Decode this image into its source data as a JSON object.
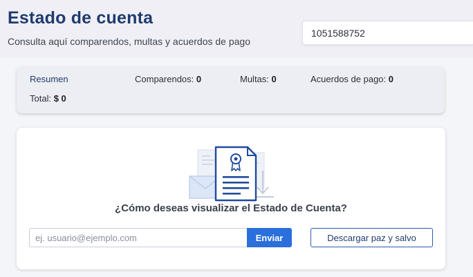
{
  "header": {
    "title": "Estado de cuenta",
    "subtitle": "Consulta aquí comparendos, multas y acuerdos de pago",
    "document_id": "1051588752"
  },
  "summary": {
    "resumen_label": "Resumen",
    "comparendos_label": "Comparendos:",
    "comparendos_value": "0",
    "multas_label": "Multas:",
    "multas_value": "0",
    "acuerdos_label": "Acuerdos de pago:",
    "acuerdos_value": "0",
    "total_label": "Total:",
    "total_value": "$ 0"
  },
  "card": {
    "illustration_icon": "document-certificate-icon",
    "question": "¿Cómo deseas visualizar el Estado de Cuenta?",
    "email_placeholder": "ej. usuario@ejemplo.com",
    "email_value": "",
    "send_label": "Enviar",
    "download_label": "Descargar paz y salvo"
  },
  "colors": {
    "title": "#1f3b6e",
    "primary_button": "#2a6fdb",
    "header_bg": "#efeff5",
    "page_bg": "#f4f5f8"
  }
}
